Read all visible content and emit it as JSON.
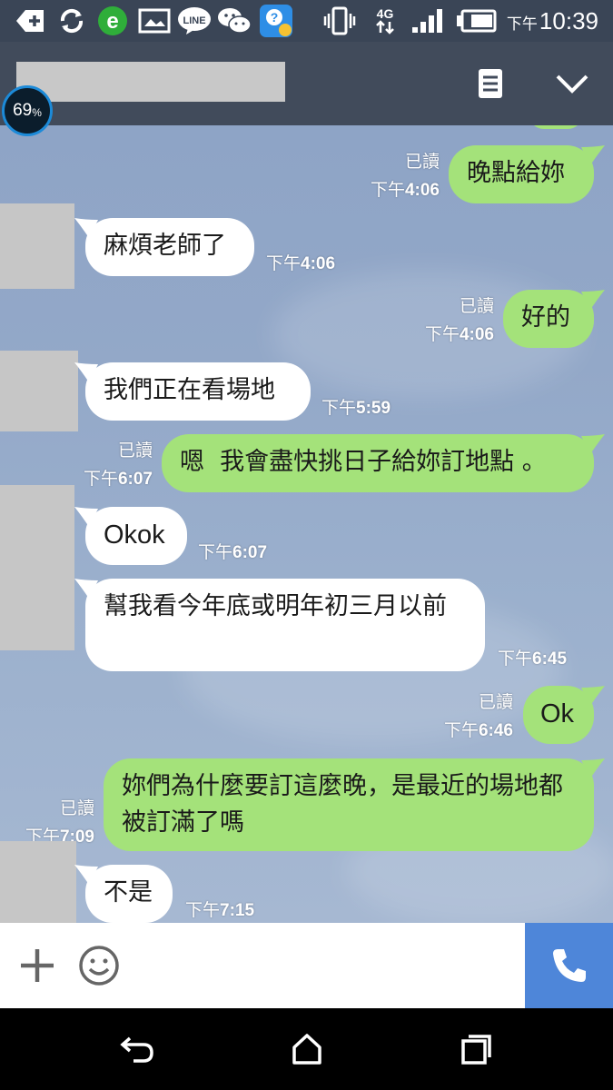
{
  "status_bar": {
    "line_icon_label": "LINE",
    "network_label": "4G",
    "ampm": "下午",
    "time": "10:39"
  },
  "battery_overlay": {
    "value": "69",
    "unit": "%"
  },
  "messages": [
    {
      "side": "out",
      "text": "晚點給妳",
      "read": "已讀",
      "time_prefix": "下午",
      "time": "4:06"
    },
    {
      "side": "in",
      "text": "麻煩老師了",
      "time_prefix": "下午",
      "time": "4:06"
    },
    {
      "side": "out",
      "text": "好的",
      "read": "已讀",
      "time_prefix": "下午",
      "time": "4:06"
    },
    {
      "side": "in",
      "text": "我們正在看場地",
      "time_prefix": "下午",
      "time": "5:59"
    },
    {
      "side": "out",
      "text": "嗯  我會盡快挑日子給妳訂地點 。",
      "read": "已讀",
      "time_prefix": "下午",
      "time": "6:07"
    },
    {
      "side": "in",
      "text": "Okok",
      "time_prefix": "下午",
      "time": "6:07"
    },
    {
      "side": "in",
      "text": "幫我看今年底或明年初三月以前",
      "time_prefix": "下午",
      "time": "6:45"
    },
    {
      "side": "out",
      "text": "Ok",
      "read": "已讀",
      "time_prefix": "下午",
      "time": "6:46"
    },
    {
      "side": "out",
      "text": "妳們為什麼要訂這麼晚，是最近的場地都被訂滿了嗎",
      "read": "已讀",
      "time_prefix": "下午",
      "time": "7:09"
    },
    {
      "side": "in",
      "text": "不是",
      "time_prefix": "下午",
      "time": "7:15"
    }
  ],
  "colors": {
    "outgoing_bubble": "#a4e27a",
    "incoming_bubble": "#ffffff",
    "header": "#414b5b",
    "call_button": "#4e86d9"
  },
  "icons": {
    "header": [
      "notes-icon",
      "chevron-down-icon"
    ],
    "input": [
      "plus-icon",
      "emoji-icon",
      "phone-icon"
    ],
    "nav": [
      "back-icon",
      "home-icon",
      "recents-icon"
    ]
  }
}
